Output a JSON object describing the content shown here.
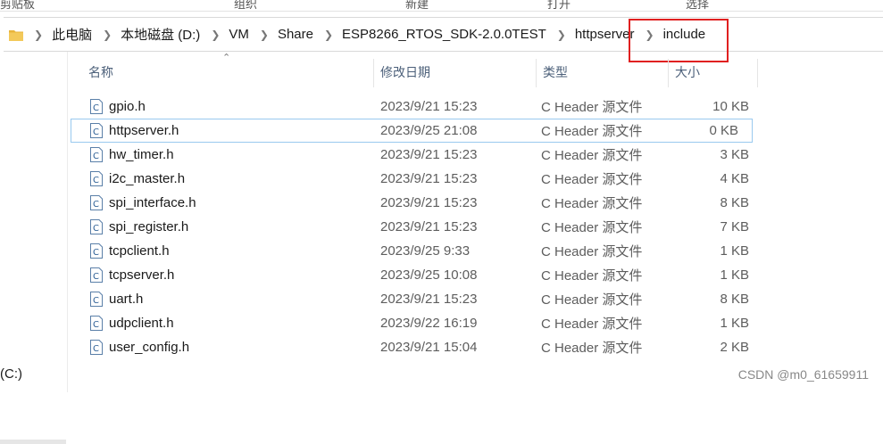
{
  "ribbon": {
    "labels": [
      "剪贴板",
      "组织",
      "新建",
      "打开",
      "选择"
    ]
  },
  "address": {
    "crumbs": [
      "此电脑",
      "本地磁盘 (D:)",
      "VM",
      "Share",
      "ESP8266_RTOS_SDK-2.0.0TEST",
      "httpserver",
      "include"
    ]
  },
  "nav": {
    "drive_label": "(C:)"
  },
  "columns": {
    "name": "名称",
    "date": "修改日期",
    "type": "类型",
    "size": "大小"
  },
  "files": [
    {
      "name": "gpio.h",
      "date": "2023/9/21 15:23",
      "type": "C Header 源文件",
      "size": "10 KB"
    },
    {
      "name": "httpserver.h",
      "date": "2023/9/25 21:08",
      "type": "C Header 源文件",
      "size": "0 KB"
    },
    {
      "name": "hw_timer.h",
      "date": "2023/9/21 15:23",
      "type": "C Header 源文件",
      "size": "3 KB"
    },
    {
      "name": "i2c_master.h",
      "date": "2023/9/21 15:23",
      "type": "C Header 源文件",
      "size": "4 KB"
    },
    {
      "name": "spi_interface.h",
      "date": "2023/9/21 15:23",
      "type": "C Header 源文件",
      "size": "8 KB"
    },
    {
      "name": "spi_register.h",
      "date": "2023/9/21 15:23",
      "type": "C Header 源文件",
      "size": "7 KB"
    },
    {
      "name": "tcpclient.h",
      "date": "2023/9/25 9:33",
      "type": "C Header 源文件",
      "size": "1 KB"
    },
    {
      "name": "tcpserver.h",
      "date": "2023/9/25 10:08",
      "type": "C Header 源文件",
      "size": "1 KB"
    },
    {
      "name": "uart.h",
      "date": "2023/9/21 15:23",
      "type": "C Header 源文件",
      "size": "8 KB"
    },
    {
      "name": "udpclient.h",
      "date": "2023/9/22 16:19",
      "type": "C Header 源文件",
      "size": "1 KB"
    },
    {
      "name": "user_config.h",
      "date": "2023/9/21 15:04",
      "type": "C Header 源文件",
      "size": "2 KB"
    }
  ],
  "selected_index": 1,
  "watermark": "CSDN @m0_61659911",
  "colors": {
    "highlight_box": "#e02020",
    "selection_border": "#99c9ef",
    "folder": "#e8b53c"
  },
  "icons": {
    "folder": "folder-icon",
    "file": "c-header-file-icon",
    "breadcrumb_separator": "chevron-right-icon",
    "sort": "sort-ascending-icon"
  }
}
